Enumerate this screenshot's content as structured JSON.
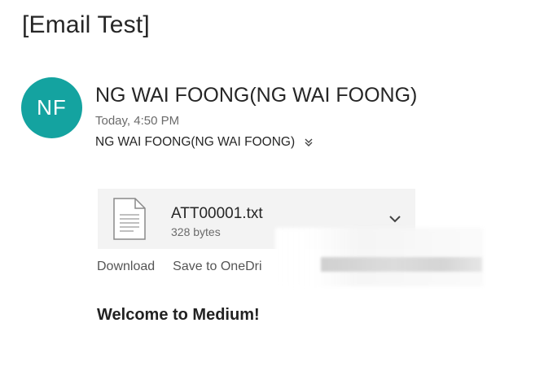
{
  "message": {
    "subject": "[Email Test]",
    "sender": {
      "initials": "NF",
      "display_name": "NG WAI FOONG(NG WAI FOONG)",
      "avatar_color": "#14a3a0"
    },
    "sent_time": "Today, 4:50 PM",
    "recipient": "NG WAI FOONG(NG WAI FOONG)",
    "body": "Welcome to Medium!"
  },
  "attachment": {
    "file_name": "ATT00001.txt",
    "file_size": "328 bytes",
    "icon": "text-file-icon",
    "actions": {
      "download_label": "Download",
      "save_label": "Save to OneDri"
    }
  }
}
